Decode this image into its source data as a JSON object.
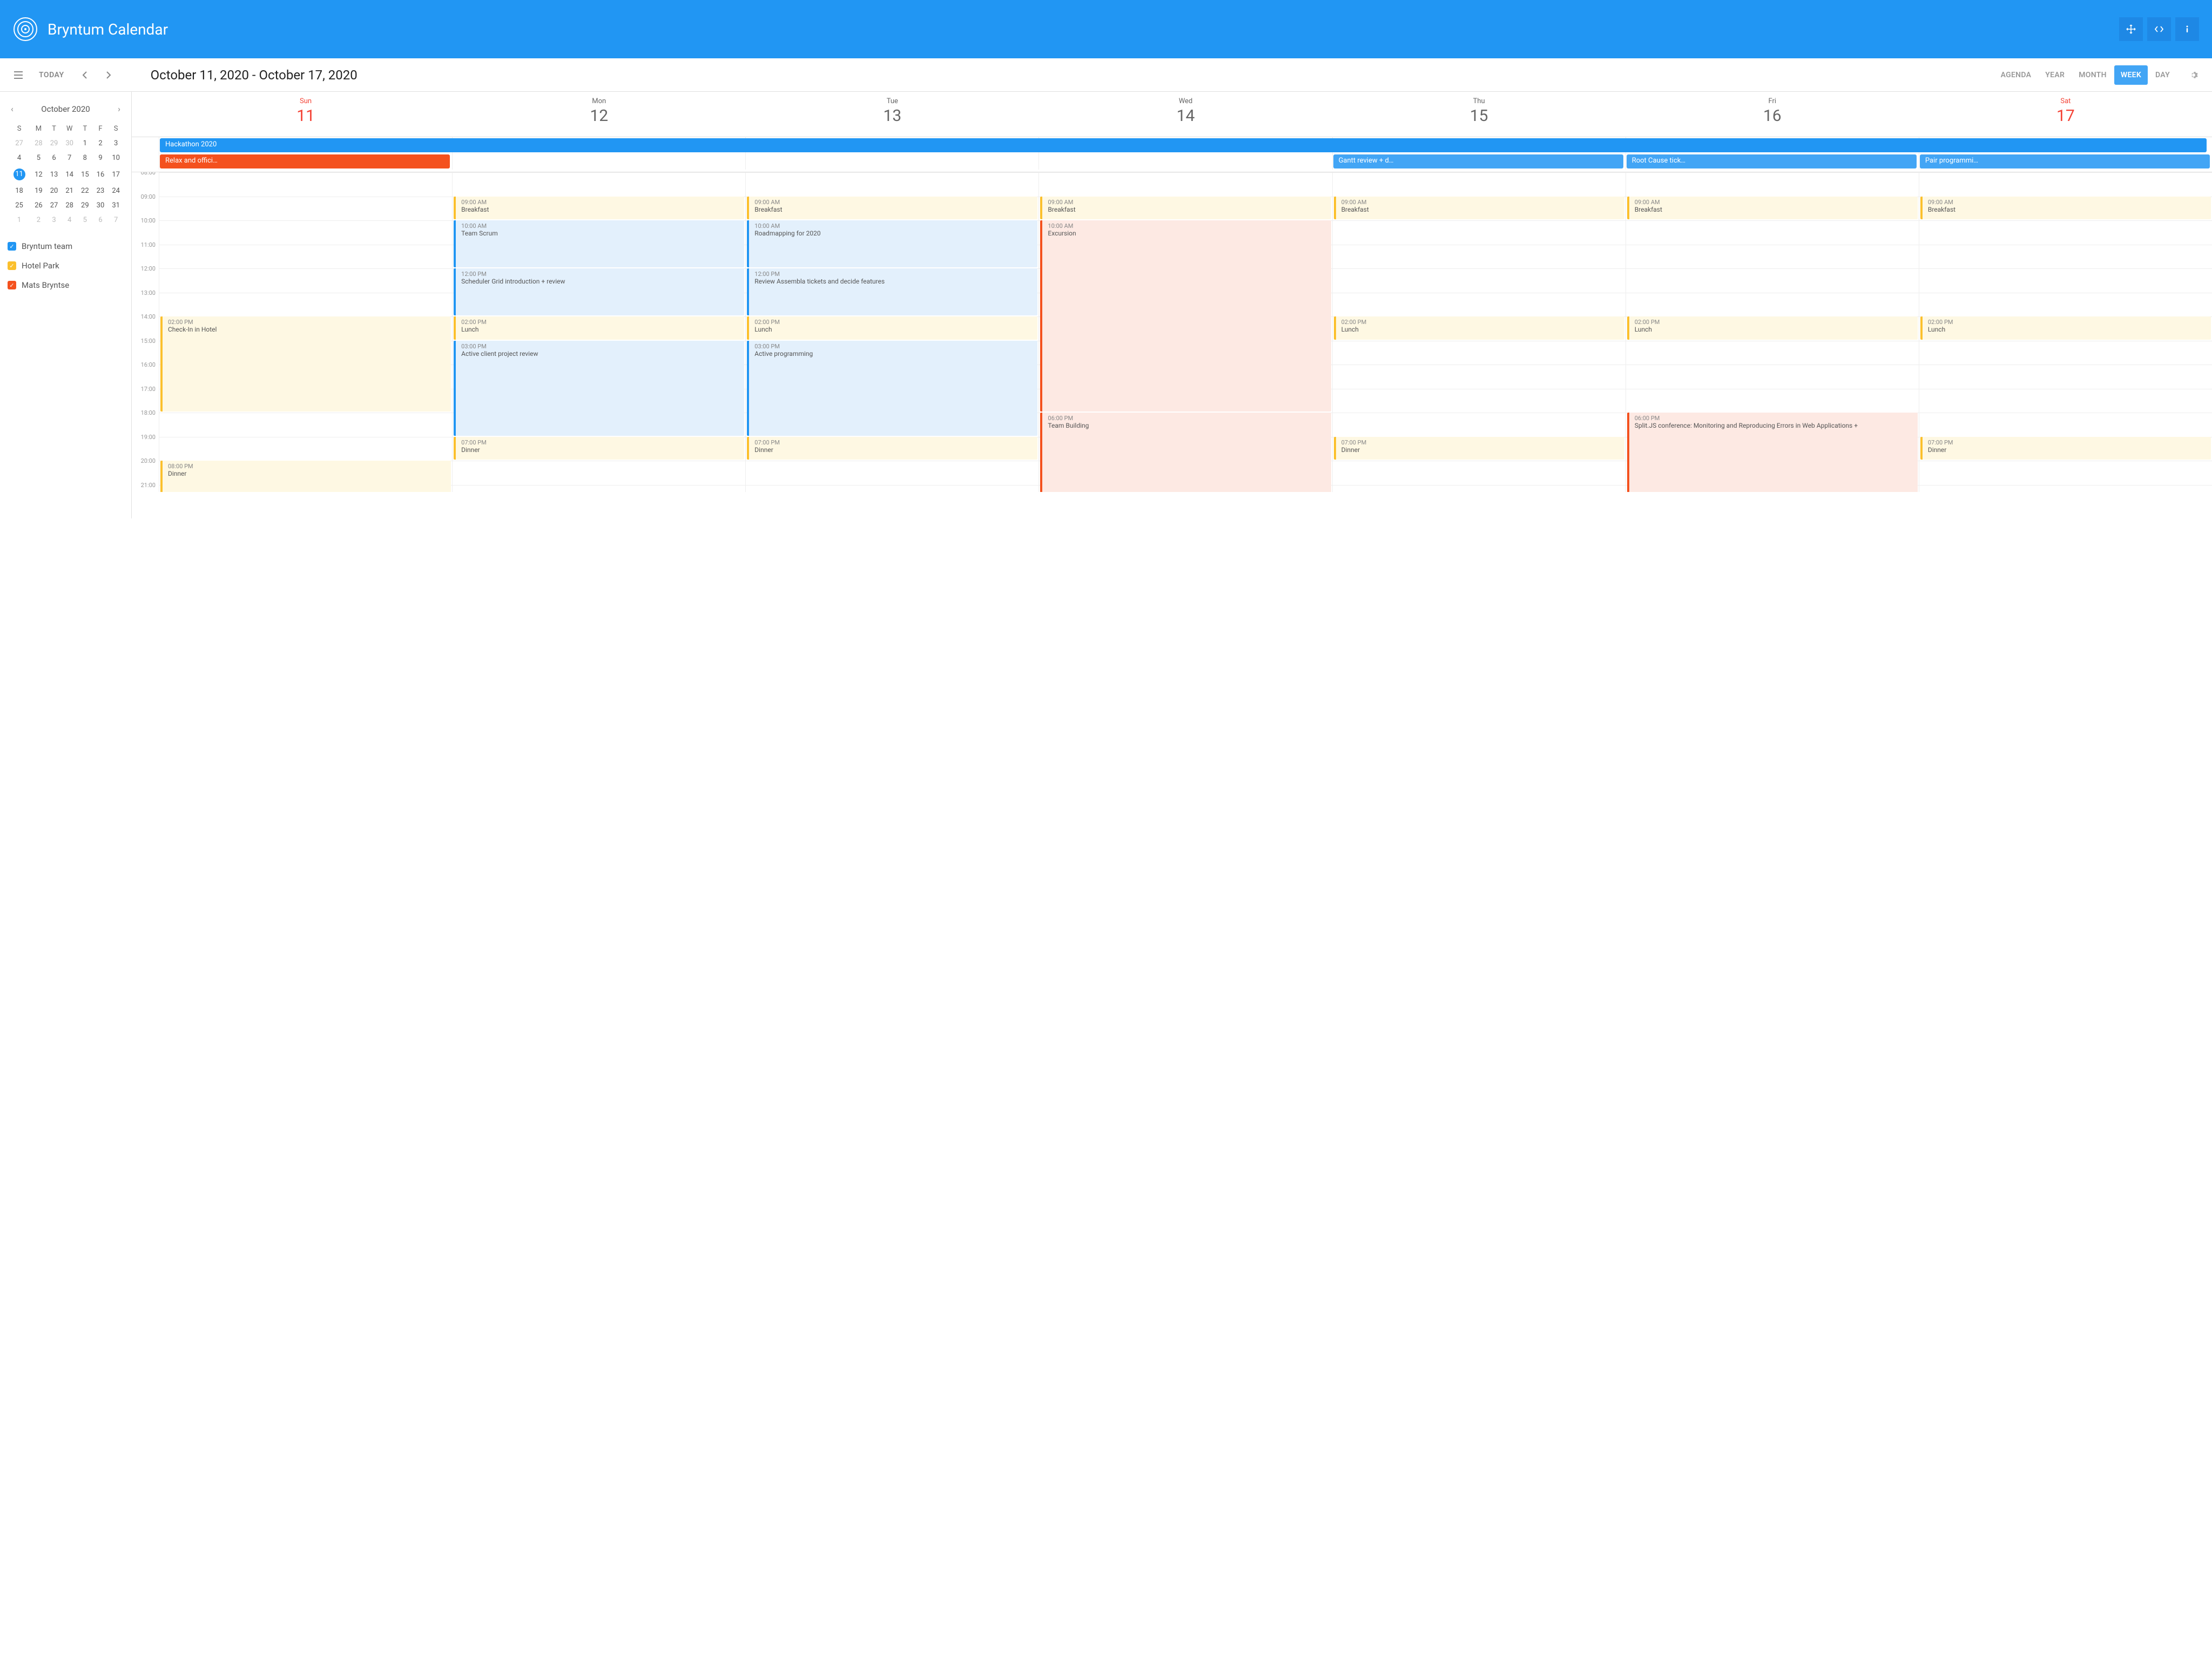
{
  "app": {
    "title": "Bryntum Calendar"
  },
  "toolbar": {
    "today": "TODAY",
    "title": "October 11, 2020 - October 17, 2020"
  },
  "views": {
    "agenda": "AGENDA",
    "year": "YEAR",
    "month": "MONTH",
    "week": "WEEK",
    "day": "DAY"
  },
  "miniCal": {
    "title": "October  2020",
    "dow": [
      "S",
      "M",
      "T",
      "W",
      "T",
      "F",
      "S"
    ],
    "weeks": [
      [
        {
          "n": 27,
          "muted": true
        },
        {
          "n": 28,
          "muted": true
        },
        {
          "n": 29,
          "muted": true
        },
        {
          "n": 30,
          "muted": true
        },
        {
          "n": 1
        },
        {
          "n": 2
        },
        {
          "n": 3
        }
      ],
      [
        {
          "n": 4
        },
        {
          "n": 5
        },
        {
          "n": 6
        },
        {
          "n": 7
        },
        {
          "n": 8
        },
        {
          "n": 9
        },
        {
          "n": 10
        }
      ],
      [
        {
          "n": 11,
          "sel": true
        },
        {
          "n": 12
        },
        {
          "n": 13
        },
        {
          "n": 14
        },
        {
          "n": 15
        },
        {
          "n": 16
        },
        {
          "n": 17
        }
      ],
      [
        {
          "n": 18
        },
        {
          "n": 19
        },
        {
          "n": 20
        },
        {
          "n": 21
        },
        {
          "n": 22
        },
        {
          "n": 23
        },
        {
          "n": 24
        }
      ],
      [
        {
          "n": 25
        },
        {
          "n": 26
        },
        {
          "n": 27
        },
        {
          "n": 28
        },
        {
          "n": 29
        },
        {
          "n": 30
        },
        {
          "n": 31
        }
      ],
      [
        {
          "n": 1,
          "muted": true
        },
        {
          "n": 2,
          "muted": true
        },
        {
          "n": 3,
          "muted": true
        },
        {
          "n": 4,
          "muted": true
        },
        {
          "n": 5,
          "muted": true
        },
        {
          "n": 6,
          "muted": true
        },
        {
          "n": 7,
          "muted": true
        }
      ]
    ]
  },
  "legend": [
    {
      "label": "Bryntum team",
      "cls": "lg-blue"
    },
    {
      "label": "Hotel Park",
      "cls": "lg-yellow"
    },
    {
      "label": "Mats Bryntse",
      "cls": "lg-red"
    }
  ],
  "days": [
    {
      "dow": "Sun",
      "num": "11",
      "weekend": true
    },
    {
      "dow": "Mon",
      "num": "12"
    },
    {
      "dow": "Tue",
      "num": "13"
    },
    {
      "dow": "Wed",
      "num": "14"
    },
    {
      "dow": "Thu",
      "num": "15"
    },
    {
      "dow": "Fri",
      "num": "16"
    },
    {
      "dow": "Sat",
      "num": "17",
      "weekend": true
    }
  ],
  "allday": {
    "row1": [
      {
        "label": "Hackathon 2020",
        "start": 0,
        "span": 7,
        "cls": "ev-blue",
        "arrow": true
      }
    ],
    "row2": [
      {
        "label": "Relax and offici…",
        "start": 0,
        "span": 1,
        "cls": "ev-red"
      },
      {
        "label": "Gantt review + d…",
        "start": 4,
        "span": 1,
        "cls": "ev-lightblue"
      },
      {
        "label": "Root Cause tick…",
        "start": 5,
        "span": 1,
        "cls": "ev-lightblue"
      },
      {
        "label": "Pair programmi…",
        "start": 6,
        "span": 1,
        "cls": "ev-lightblue"
      }
    ]
  },
  "hourStart": 8,
  "hourEnd": 21,
  "pxPerHour": 44.5,
  "events": [
    {
      "day": 0,
      "start": 14,
      "end": 18,
      "time": "02:00 PM",
      "title": "Check-In in Hotel",
      "cal": "yellow"
    },
    {
      "day": 0,
      "start": 20,
      "end": 21.5,
      "time": "08:00 PM",
      "title": "Dinner",
      "cal": "yellow"
    },
    {
      "day": 1,
      "start": 9,
      "end": 10,
      "time": "09:00 AM",
      "title": "Breakfast",
      "cal": "yellow"
    },
    {
      "day": 1,
      "start": 10,
      "end": 12,
      "time": "10:00 AM",
      "title": "Team Scrum",
      "cal": "blue"
    },
    {
      "day": 1,
      "start": 12,
      "end": 14,
      "time": "12:00 PM",
      "title": "Scheduler Grid introduction + review",
      "cal": "blue"
    },
    {
      "day": 1,
      "start": 14,
      "end": 15,
      "time": "02:00 PM",
      "title": "Lunch",
      "cal": "yellow"
    },
    {
      "day": 1,
      "start": 15,
      "end": 19,
      "time": "03:00 PM",
      "title": "Active client project review",
      "cal": "blue"
    },
    {
      "day": 1,
      "start": 19,
      "end": 20,
      "time": "07:00 PM",
      "title": "Dinner",
      "cal": "yellow"
    },
    {
      "day": 2,
      "start": 9,
      "end": 10,
      "time": "09:00 AM",
      "title": "Breakfast",
      "cal": "yellow"
    },
    {
      "day": 2,
      "start": 10,
      "end": 12,
      "time": "10:00 AM",
      "title": "Roadmapping for 2020",
      "cal": "blue"
    },
    {
      "day": 2,
      "start": 12,
      "end": 14,
      "time": "12:00 PM",
      "title": "Review Assembla tickets and decide features",
      "cal": "blue"
    },
    {
      "day": 2,
      "start": 14,
      "end": 15,
      "time": "02:00 PM",
      "title": "Lunch",
      "cal": "yellow"
    },
    {
      "day": 2,
      "start": 15,
      "end": 19,
      "time": "03:00 PM",
      "title": "Active programming",
      "cal": "blue"
    },
    {
      "day": 2,
      "start": 19,
      "end": 20,
      "time": "07:00 PM",
      "title": "Dinner",
      "cal": "yellow"
    },
    {
      "day": 3,
      "start": 9,
      "end": 10,
      "time": "09:00 AM",
      "title": "Breakfast",
      "cal": "yellow"
    },
    {
      "day": 3,
      "start": 10,
      "end": 18,
      "time": "10:00 AM",
      "title": "Excursion",
      "cal": "red"
    },
    {
      "day": 3,
      "start": 18,
      "end": 22,
      "time": "06:00 PM",
      "title": "Team Building",
      "cal": "red"
    },
    {
      "day": 4,
      "start": 9,
      "end": 10,
      "time": "09:00 AM",
      "title": "Breakfast",
      "cal": "yellow"
    },
    {
      "day": 4,
      "start": 14,
      "end": 15,
      "time": "02:00 PM",
      "title": "Lunch",
      "cal": "yellow"
    },
    {
      "day": 4,
      "start": 19,
      "end": 20,
      "time": "07:00 PM",
      "title": "Dinner",
      "cal": "yellow"
    },
    {
      "day": 5,
      "start": 9,
      "end": 10,
      "time": "09:00 AM",
      "title": "Breakfast",
      "cal": "yellow"
    },
    {
      "day": 5,
      "start": 14,
      "end": 15,
      "time": "02:00 PM",
      "title": "Lunch",
      "cal": "yellow"
    },
    {
      "day": 5,
      "start": 18,
      "end": 22,
      "time": "06:00 PM",
      "title": "Split.JS conference: Monitoring and Reproducing Errors in Web Applications + ",
      "cal": "red"
    },
    {
      "day": 6,
      "start": 9,
      "end": 10,
      "time": "09:00 AM",
      "title": "Breakfast",
      "cal": "yellow"
    },
    {
      "day": 6,
      "start": 14,
      "end": 15,
      "time": "02:00 PM",
      "title": "Lunch",
      "cal": "yellow"
    },
    {
      "day": 6,
      "start": 19,
      "end": 20,
      "time": "07:00 PM",
      "title": "Dinner",
      "cal": "yellow"
    }
  ]
}
